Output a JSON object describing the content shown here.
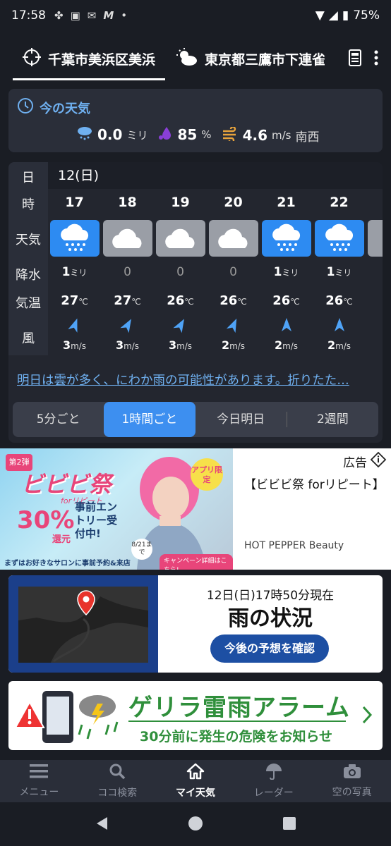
{
  "status_bar": {
    "time": "17:58",
    "battery": "75%"
  },
  "locations": {
    "tabs": [
      {
        "label": "千葉市美浜区美浜",
        "icon": "location-target-icon",
        "active": true
      },
      {
        "label": "東京都三鷹市下連雀",
        "icon": "sun-cloud-icon",
        "active": false
      }
    ]
  },
  "current": {
    "title": "今の天気",
    "precip_value": "0.0",
    "precip_unit": "ミリ",
    "humidity_value": "85",
    "humidity_unit": "%",
    "wind_value": "4.6",
    "wind_unit": "m/s",
    "wind_dir": "南西"
  },
  "forecast": {
    "labels": {
      "day": "日",
      "hour": "時",
      "weather": "天気",
      "precip": "降水",
      "temp": "気温",
      "wind": "風"
    },
    "day": "12(日)",
    "hours": [
      {
        "hour": "17",
        "weather": "rain",
        "precip": "1",
        "precip_unit": "ミリ",
        "temp": "27",
        "temp_unit": "℃",
        "wind": "3",
        "wind_unit": "m/s",
        "wind_rot": 20
      },
      {
        "hour": "18",
        "weather": "cloud",
        "precip": "0",
        "precip_unit": "",
        "temp": "27",
        "temp_unit": "℃",
        "wind": "3",
        "wind_unit": "m/s",
        "wind_rot": 30
      },
      {
        "hour": "19",
        "weather": "cloud",
        "precip": "0",
        "precip_unit": "",
        "temp": "26",
        "temp_unit": "℃",
        "wind": "3",
        "wind_unit": "m/s",
        "wind_rot": 30
      },
      {
        "hour": "20",
        "weather": "cloud",
        "precip": "0",
        "precip_unit": "",
        "temp": "26",
        "temp_unit": "℃",
        "wind": "2",
        "wind_unit": "m/s",
        "wind_rot": 25
      },
      {
        "hour": "21",
        "weather": "rain",
        "precip": "1",
        "precip_unit": "ミリ",
        "temp": "26",
        "temp_unit": "℃",
        "wind": "2",
        "wind_unit": "m/s",
        "wind_rot": 0
      },
      {
        "hour": "22",
        "weather": "rain",
        "precip": "1",
        "precip_unit": "ミリ",
        "temp": "26",
        "temp_unit": "℃",
        "wind": "2",
        "wind_unit": "m/s",
        "wind_rot": 0
      }
    ],
    "summary": "明日は雲が多く、にわか雨の可能性があります。折りたた…",
    "segments": [
      "5分ごと",
      "1時間ごと",
      "今日明日",
      "2週間"
    ],
    "active_segment": 1
  },
  "ad": {
    "label": "広告",
    "title": "【ビビビ祭 forリピート】",
    "source": "HOT PEPPER Beauty",
    "image_texts": {
      "badge": "第2弾",
      "event": "ビビビ祭",
      "for_repeat": "forリピート",
      "points": "30%",
      "points_label": "還元",
      "entry": "事前エントリー受付中!",
      "app_only": "アプリ限定",
      "until": "8/21まで",
      "campaign": "キャンペーン詳細はこちら!",
      "bottom": "まずはお好きなサロンに事前予約&来店"
    }
  },
  "rain_banner": {
    "time": "12日(日)17時50分現在",
    "title": "雨の状況",
    "button": "今後の予想を確認"
  },
  "guerrilla": {
    "title": "ゲリラ雷雨アラーム",
    "subtitle": "30分前に発生の危険をお知らせ"
  },
  "bottom_nav": [
    {
      "label": "メニュー",
      "icon": "menu-icon",
      "active": false
    },
    {
      "label": "ココ検索",
      "icon": "search-icon",
      "active": false
    },
    {
      "label": "マイ天気",
      "icon": "home-icon",
      "active": true
    },
    {
      "label": "レーダー",
      "icon": "radar-umbrella-icon",
      "active": false
    },
    {
      "label": "空の写真",
      "icon": "camera-icon",
      "active": false
    }
  ],
  "colors": {
    "accent": "#3d8ff0",
    "rain_tile": "#2d8bf2",
    "cloud_tile": "#9a9ea6",
    "link": "#6fb0f0",
    "guerrilla_green": "#2f8f3b"
  }
}
